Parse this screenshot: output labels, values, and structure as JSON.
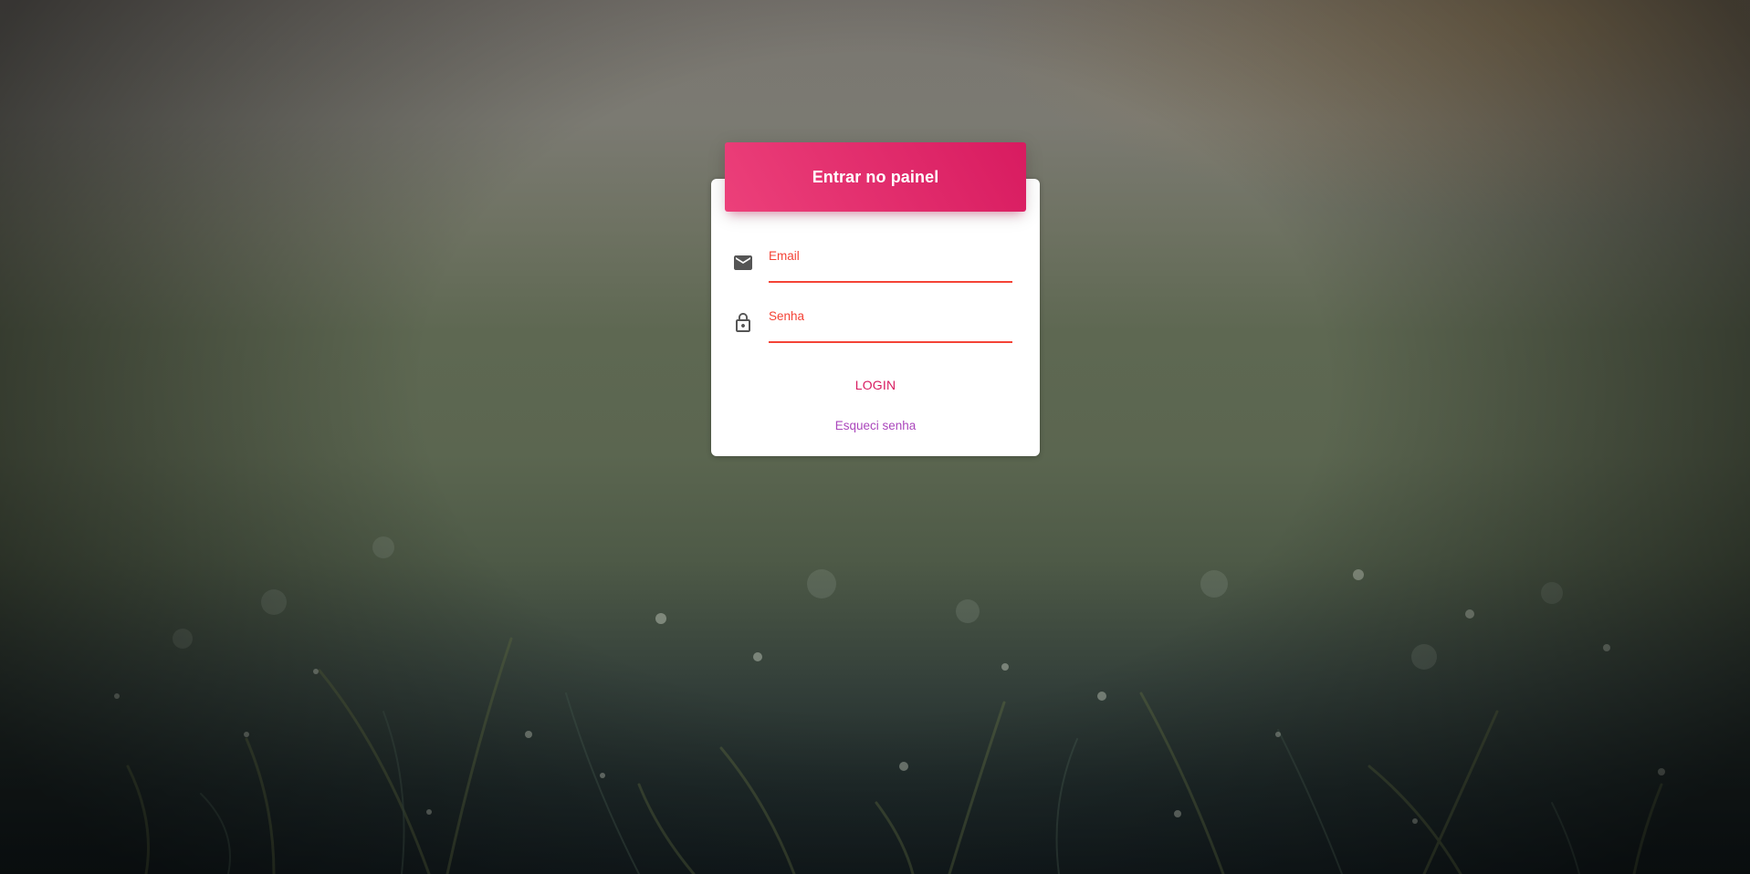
{
  "background": {
    "description_icon": "grass-dew-photo"
  },
  "login_card": {
    "title": "Entrar no painel",
    "email": {
      "label": "Email",
      "value": "",
      "icon": "mail-icon"
    },
    "password": {
      "label": "Senha",
      "value": "",
      "icon": "lock-icon"
    },
    "login_label": "LOGIN",
    "forgot_label": "Esqueci senha"
  },
  "colors": {
    "header_gradient_start": "#ec407a",
    "header_gradient_end": "#d81b60",
    "input_accent": "#f44336",
    "login_text": "#d81b60",
    "forgot_text": "#ab47bc",
    "card_bg": "#ffffff"
  }
}
